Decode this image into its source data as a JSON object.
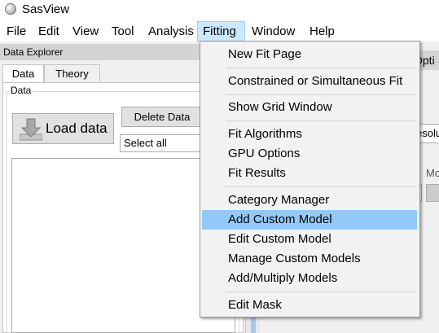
{
  "window": {
    "title": "SasView"
  },
  "menubar": {
    "items": [
      {
        "label": "File"
      },
      {
        "label": "Edit"
      },
      {
        "label": "View"
      },
      {
        "label": "Tool"
      },
      {
        "label": "Analysis"
      },
      {
        "label": "Fitting",
        "active": true
      },
      {
        "label": "Window"
      },
      {
        "label": "Help"
      }
    ]
  },
  "data_explorer": {
    "title": "Data Explorer",
    "tabs": [
      {
        "label": "Data",
        "selected": true
      },
      {
        "label": "Theory",
        "selected": false
      }
    ],
    "group_label": "Data",
    "load_button": "Load data",
    "delete_button": "Delete Data",
    "select_value": "Select all"
  },
  "background": {
    "right_tab_text": "Opti",
    "right_combo_text": "esolu",
    "right_label": "Mo"
  },
  "fitting_menu": {
    "groups": [
      [
        "New Fit Page"
      ],
      [
        "Constrained or Simultaneous Fit"
      ],
      [
        "Show Grid Window"
      ],
      [
        "Fit Algorithms",
        "GPU Options",
        "Fit Results"
      ],
      [
        "Category Manager",
        "Add Custom Model",
        "Edit Custom Model",
        "Manage Custom Models",
        "Add/Multiply Models"
      ],
      [
        "Edit Mask"
      ]
    ],
    "highlighted": "Add Custom Model"
  },
  "colors": {
    "menu_highlight": "#91c9f7",
    "active_menu_bg": "#cce8ff",
    "load_icon_arrow": "#a0a0a0"
  },
  "icons": {
    "app": "sasview-app-icon",
    "load": "download-arrow-icon"
  }
}
